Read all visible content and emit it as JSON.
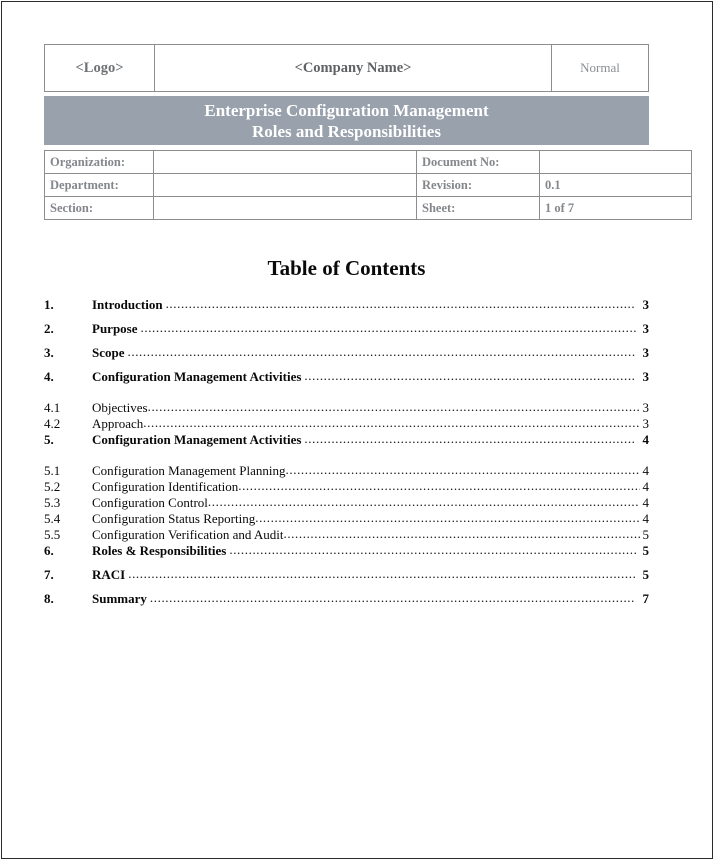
{
  "document_header": {
    "logo_cell": "<Logo>",
    "company_cell": "<Company Name>",
    "status_cell": "Normal",
    "title_line1": "Enterprise Configuration Management",
    "title_line2": "Roles and Responsibilities",
    "banner_color": "#99a1ad",
    "info_rows": [
      {
        "label_left": "Organization:",
        "value_left": "",
        "label_right": "Document No:",
        "value_right": ""
      },
      {
        "label_left": "Department:",
        "value_left": "",
        "label_right": "Revision:",
        "value_right": "0.1"
      },
      {
        "label_left": "Section:",
        "value_left": "",
        "label_right": "Sheet:",
        "value_right": "1 of 7"
      }
    ]
  },
  "toc": {
    "heading": "Table of Contents",
    "dot_leader": "...........................................................................................................................................................................................................................",
    "entries": [
      {
        "number": "1.",
        "title": "Introduction",
        "page": "3",
        "level": 1
      },
      {
        "number": "2.",
        "title": "Purpose",
        "page": "3",
        "level": 1
      },
      {
        "number": "3.",
        "title": "Scope ",
        "page": "3",
        "level": 1
      },
      {
        "number": "4.",
        "title": "Configuration Management Activities ",
        "page": "3",
        "level": 1
      },
      {
        "number": "4.1",
        "title": "Objectives",
        "page": "3",
        "level": 2
      },
      {
        "number": "4.2",
        "title": "Approach",
        "page": "3",
        "level": 2
      },
      {
        "number": "5.",
        "title": "Configuration Management Activities ",
        "page": "4",
        "level": 1
      },
      {
        "number": "5.1",
        "title": "Configuration Management Planning",
        "page": "4",
        "level": 2
      },
      {
        "number": "5.2",
        "title": "Configuration Identification ",
        "page": "4",
        "level": 2
      },
      {
        "number": "5.3",
        "title": "Configuration Control",
        "page": "4",
        "level": 2
      },
      {
        "number": "5.4",
        "title": "Configuration Status Reporting",
        "page": "4",
        "level": 2
      },
      {
        "number": "5.5",
        "title": "Configuration Verification and Audit",
        "page": "5",
        "level": 2
      },
      {
        "number": "6.",
        "title": "Roles & Responsibilities ",
        "page": "5",
        "level": 1
      },
      {
        "number": "7.",
        "title": "RACI ",
        "page": "5",
        "level": 1
      },
      {
        "number": "8.",
        "title": "Summary",
        "page": "7",
        "level": 1
      }
    ]
  }
}
